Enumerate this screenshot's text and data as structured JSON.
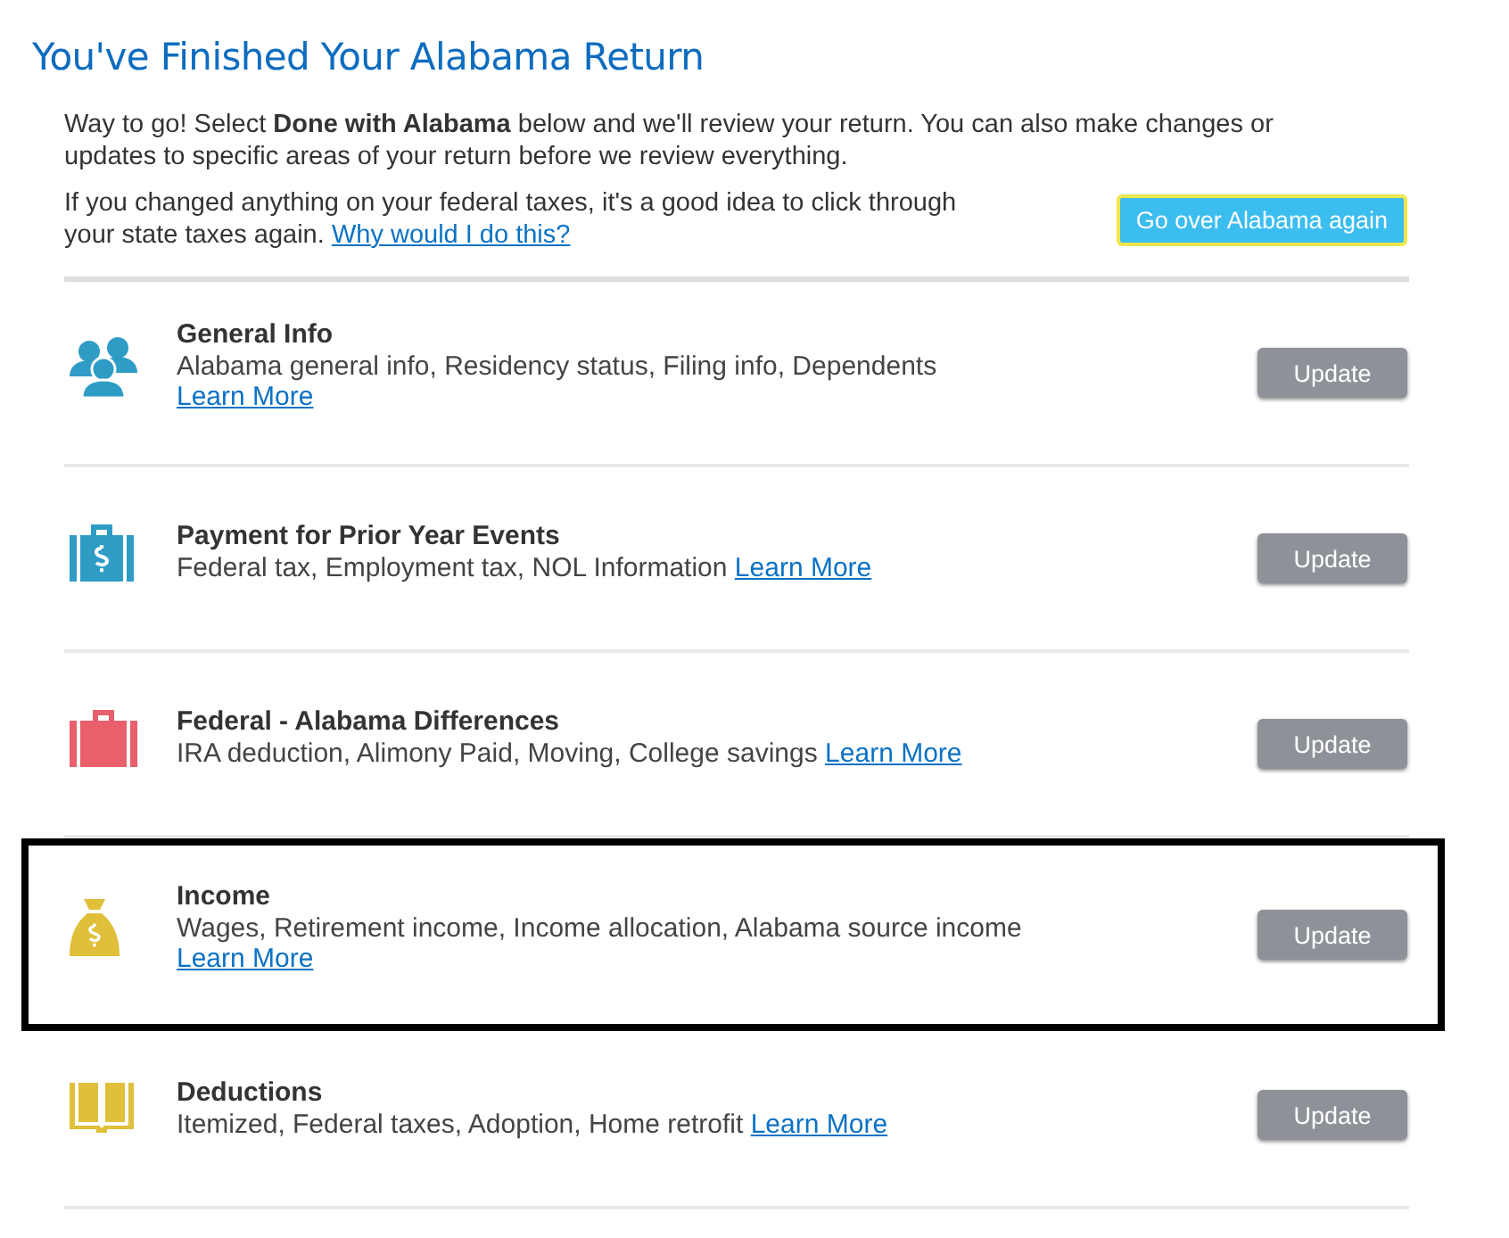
{
  "title": "You've Finished Your Alabama Return",
  "intro": "Way to go! Select **Done with Alabama** below and we'll review your return. You can also make changes or updates to specific areas of your return before we review everything.",
  "recheck": {
    "text": "If you changed anything on your federal taxes, it's a good idea to click through your state taxes again.",
    "link": "Why would I do this?",
    "button": "Go over Alabama again"
  },
  "sections": [
    {
      "kind": "people",
      "title": "General Info",
      "description": "Alabama general info, Residency status, Filing info, Dependents",
      "link": "Learn More",
      "button": "Update",
      "highlighted": false
    },
    {
      "kind": "briefcase",
      "title": "Payment for Prior Year Events",
      "description": "Federal tax, Employment tax, NOL Information",
      "link": "Learn More",
      "button": "Update",
      "highlighted": false
    },
    {
      "kind": "suitcase",
      "title": "Federal - Alabama Differences",
      "description": "IRA deduction, Alimony Paid, Moving, College savings",
      "link": "Learn More",
      "button": "Update",
      "highlighted": false
    },
    {
      "kind": "bag",
      "title": "Income",
      "description": "Wages, Retirement income, Income allocation, Alabama source income",
      "link": "Learn More",
      "button": "Update",
      "highlighted": true
    },
    {
      "kind": "book",
      "title": "Deductions",
      "description": "Itemized, Federal taxes, Adoption, Home retrofit",
      "link": "Learn More",
      "button": "Update",
      "highlighted": false
    }
  ]
}
